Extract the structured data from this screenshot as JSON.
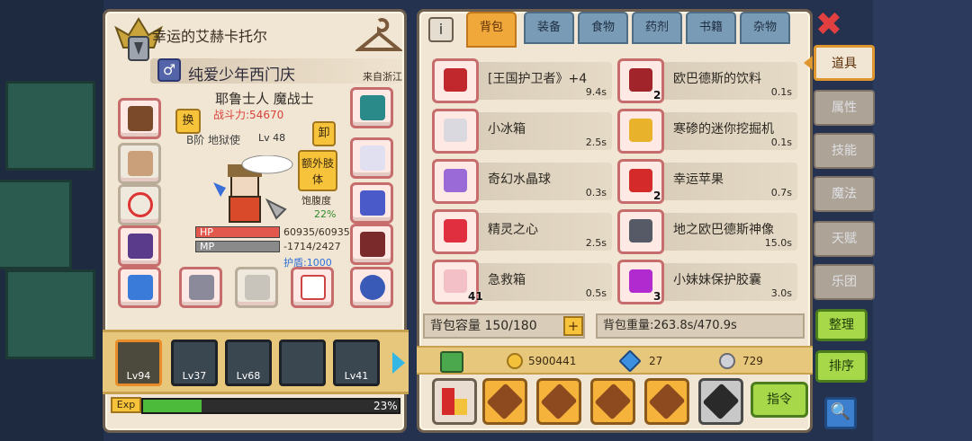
{
  "character": {
    "title": "幸运的艾赫卡托尔",
    "name": "纯爱少年西门庆",
    "gender_symbol": "♂",
    "origin": "来自浙江",
    "class_line": "耶鲁士人 魔战士",
    "power": "战斗力:54670",
    "rank": "B阶 地狱使",
    "level": "Lv 48",
    "swap_label": "换",
    "unequip_label": "卸",
    "extra_label": "额外肢体",
    "satiety_label": "饱腹度",
    "satiety_value": "22%",
    "hp_label": "HP",
    "mp_label": "MP",
    "hp_value": "60935/60935",
    "mp_value": "-1714/2427",
    "shield_value": "护盾:1000",
    "exp_label": "Exp",
    "exp_percent": "23%",
    "exp_fraction": 0.23
  },
  "party": [
    {
      "level": "Lv94",
      "selected": true
    },
    {
      "level": "Lv37",
      "selected": false
    },
    {
      "level": "Lv68",
      "selected": false
    },
    {
      "level": "",
      "selected": false
    },
    {
      "level": "Lv41",
      "selected": false
    }
  ],
  "bag": {
    "info_label": "i",
    "tabs": [
      "背包",
      "装备",
      "食物",
      "药剂",
      "书籍",
      "杂物"
    ],
    "active_tab": "背包",
    "items": [
      {
        "name": "[王国护卫者》+4",
        "weight": "9.4s",
        "count": "",
        "icon": "red-crossbow-icon",
        "color": "#c0282d"
      },
      {
        "name": "欧巴德斯的饮料",
        "weight": "0.1s",
        "count": "2",
        "icon": "drink-bottle-icon",
        "color": "#a0242a"
      },
      {
        "name": "小冰箱",
        "weight": "2.5s",
        "count": "",
        "icon": "fridge-icon",
        "color": "#d9d9df"
      },
      {
        "name": "寒碜的迷你挖掘机",
        "weight": "0.1s",
        "count": "",
        "icon": "excavator-icon",
        "color": "#e8b32a"
      },
      {
        "name": "奇幻水晶球",
        "weight": "0.3s",
        "count": "",
        "icon": "crystal-ball-icon",
        "color": "#9a6ad6"
      },
      {
        "name": "幸运苹果",
        "weight": "0.7s",
        "count": "2",
        "icon": "apple-icon",
        "color": "#d42a2a"
      },
      {
        "name": "精灵之心",
        "weight": "2.5s",
        "count": "",
        "icon": "heart-icon",
        "color": "#e03040"
      },
      {
        "name": "地之欧巴德斯神像",
        "weight": "15.0s",
        "count": "",
        "icon": "statue-icon",
        "color": "#555a66"
      },
      {
        "name": "急救箱",
        "weight": "0.5s",
        "count": "41",
        "icon": "first-aid-kit-icon",
        "color": "#f3c0c8"
      },
      {
        "name": "小妹妹保护胶囊",
        "weight": "3.0s",
        "count": "3",
        "icon": "capsule-icon",
        "color": "#b02ad0"
      }
    ],
    "capacity": "背包容量 150/180",
    "capacity_plus": "+",
    "weight": "背包重量:263.8s/470.9s",
    "gold": "5900441",
    "diamonds": "27",
    "silver": "729",
    "command_label": "指令"
  },
  "side_menu": {
    "tabs": [
      "道具",
      "属性",
      "技能",
      "魔法",
      "天赋",
      "乐团"
    ],
    "active": "道具",
    "sort_label": "整理",
    "order_label": "排序",
    "close_symbol": "✖",
    "search_symbol": "🔍"
  }
}
